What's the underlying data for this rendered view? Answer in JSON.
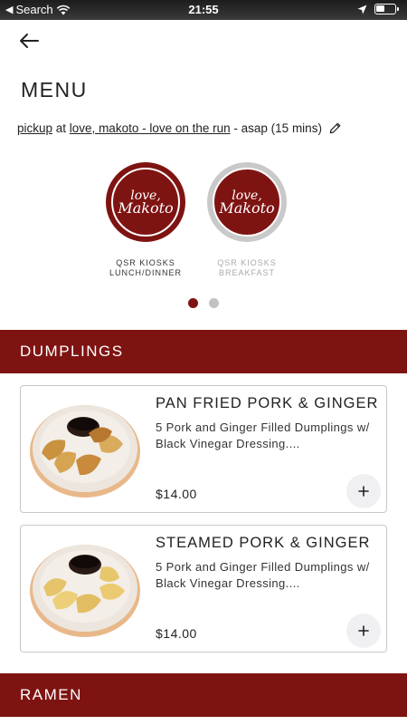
{
  "status_bar": {
    "carrier": "Search",
    "time": "21:55"
  },
  "page": {
    "title": "MENU"
  },
  "order": {
    "mode": "pickup",
    "at": " at ",
    "location": "love, makoto - love on the run",
    "timing": " - asap (15 mins)"
  },
  "menus": [
    {
      "label_line1": "QSR KIOSKS",
      "label_line2": "LUNCH/DINNER",
      "logo_line1": "love,",
      "logo_line2": "Makoto",
      "active": true
    },
    {
      "label_line1": "QSR KIOSKS",
      "label_line2": "BREAKFAST",
      "logo_line1": "love,",
      "logo_line2": "Makoto",
      "active": false
    }
  ],
  "pagination": {
    "current": 1,
    "total": 2
  },
  "categories": [
    {
      "name": "DUMPLINGS",
      "items": [
        {
          "name": "PAN FRIED PORK & GINGER",
          "description": "5 Pork and Ginger Filled Dumplings w/ Black Vinegar Dressing....",
          "price": "$14.00"
        },
        {
          "name": "STEAMED PORK & GINGER",
          "description": "5 Pork and Ginger Filled Dumplings w/ Black Vinegar Dressing....",
          "price": "$14.00"
        }
      ]
    },
    {
      "name": "RAMEN",
      "items": []
    }
  ],
  "colors": {
    "brand": "#7e1412",
    "inactive_dot": "#c2c2c2"
  },
  "icons": {
    "back": "arrow-left-icon",
    "edit": "pencil-icon",
    "add": "plus-icon"
  }
}
